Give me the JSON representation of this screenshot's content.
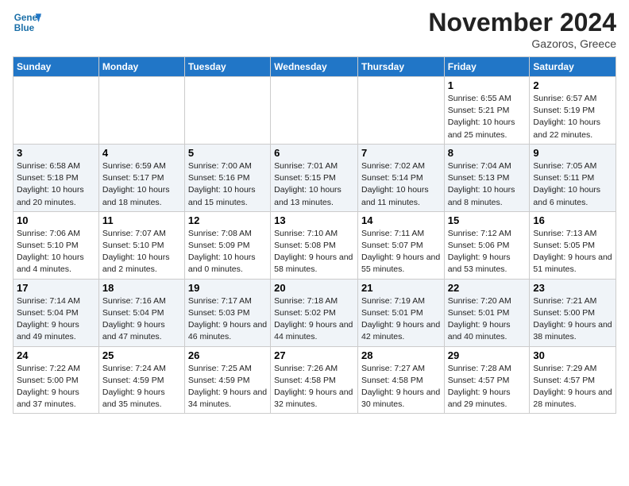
{
  "header": {
    "logo_line1": "General",
    "logo_line2": "Blue",
    "month": "November 2024",
    "location": "Gazoros, Greece"
  },
  "days_of_week": [
    "Sunday",
    "Monday",
    "Tuesday",
    "Wednesday",
    "Thursday",
    "Friday",
    "Saturday"
  ],
  "weeks": [
    [
      {
        "day": "",
        "info": ""
      },
      {
        "day": "",
        "info": ""
      },
      {
        "day": "",
        "info": ""
      },
      {
        "day": "",
        "info": ""
      },
      {
        "day": "",
        "info": ""
      },
      {
        "day": "1",
        "info": "Sunrise: 6:55 AM\nSunset: 5:21 PM\nDaylight: 10 hours and 25 minutes."
      },
      {
        "day": "2",
        "info": "Sunrise: 6:57 AM\nSunset: 5:19 PM\nDaylight: 10 hours and 22 minutes."
      }
    ],
    [
      {
        "day": "3",
        "info": "Sunrise: 6:58 AM\nSunset: 5:18 PM\nDaylight: 10 hours and 20 minutes."
      },
      {
        "day": "4",
        "info": "Sunrise: 6:59 AM\nSunset: 5:17 PM\nDaylight: 10 hours and 18 minutes."
      },
      {
        "day": "5",
        "info": "Sunrise: 7:00 AM\nSunset: 5:16 PM\nDaylight: 10 hours and 15 minutes."
      },
      {
        "day": "6",
        "info": "Sunrise: 7:01 AM\nSunset: 5:15 PM\nDaylight: 10 hours and 13 minutes."
      },
      {
        "day": "7",
        "info": "Sunrise: 7:02 AM\nSunset: 5:14 PM\nDaylight: 10 hours and 11 minutes."
      },
      {
        "day": "8",
        "info": "Sunrise: 7:04 AM\nSunset: 5:13 PM\nDaylight: 10 hours and 8 minutes."
      },
      {
        "day": "9",
        "info": "Sunrise: 7:05 AM\nSunset: 5:11 PM\nDaylight: 10 hours and 6 minutes."
      }
    ],
    [
      {
        "day": "10",
        "info": "Sunrise: 7:06 AM\nSunset: 5:10 PM\nDaylight: 10 hours and 4 minutes."
      },
      {
        "day": "11",
        "info": "Sunrise: 7:07 AM\nSunset: 5:10 PM\nDaylight: 10 hours and 2 minutes."
      },
      {
        "day": "12",
        "info": "Sunrise: 7:08 AM\nSunset: 5:09 PM\nDaylight: 10 hours and 0 minutes."
      },
      {
        "day": "13",
        "info": "Sunrise: 7:10 AM\nSunset: 5:08 PM\nDaylight: 9 hours and 58 minutes."
      },
      {
        "day": "14",
        "info": "Sunrise: 7:11 AM\nSunset: 5:07 PM\nDaylight: 9 hours and 55 minutes."
      },
      {
        "day": "15",
        "info": "Sunrise: 7:12 AM\nSunset: 5:06 PM\nDaylight: 9 hours and 53 minutes."
      },
      {
        "day": "16",
        "info": "Sunrise: 7:13 AM\nSunset: 5:05 PM\nDaylight: 9 hours and 51 minutes."
      }
    ],
    [
      {
        "day": "17",
        "info": "Sunrise: 7:14 AM\nSunset: 5:04 PM\nDaylight: 9 hours and 49 minutes."
      },
      {
        "day": "18",
        "info": "Sunrise: 7:16 AM\nSunset: 5:04 PM\nDaylight: 9 hours and 47 minutes."
      },
      {
        "day": "19",
        "info": "Sunrise: 7:17 AM\nSunset: 5:03 PM\nDaylight: 9 hours and 46 minutes."
      },
      {
        "day": "20",
        "info": "Sunrise: 7:18 AM\nSunset: 5:02 PM\nDaylight: 9 hours and 44 minutes."
      },
      {
        "day": "21",
        "info": "Sunrise: 7:19 AM\nSunset: 5:01 PM\nDaylight: 9 hours and 42 minutes."
      },
      {
        "day": "22",
        "info": "Sunrise: 7:20 AM\nSunset: 5:01 PM\nDaylight: 9 hours and 40 minutes."
      },
      {
        "day": "23",
        "info": "Sunrise: 7:21 AM\nSunset: 5:00 PM\nDaylight: 9 hours and 38 minutes."
      }
    ],
    [
      {
        "day": "24",
        "info": "Sunrise: 7:22 AM\nSunset: 5:00 PM\nDaylight: 9 hours and 37 minutes."
      },
      {
        "day": "25",
        "info": "Sunrise: 7:24 AM\nSunset: 4:59 PM\nDaylight: 9 hours and 35 minutes."
      },
      {
        "day": "26",
        "info": "Sunrise: 7:25 AM\nSunset: 4:59 PM\nDaylight: 9 hours and 34 minutes."
      },
      {
        "day": "27",
        "info": "Sunrise: 7:26 AM\nSunset: 4:58 PM\nDaylight: 9 hours and 32 minutes."
      },
      {
        "day": "28",
        "info": "Sunrise: 7:27 AM\nSunset: 4:58 PM\nDaylight: 9 hours and 30 minutes."
      },
      {
        "day": "29",
        "info": "Sunrise: 7:28 AM\nSunset: 4:57 PM\nDaylight: 9 hours and 29 minutes."
      },
      {
        "day": "30",
        "info": "Sunrise: 7:29 AM\nSunset: 4:57 PM\nDaylight: 9 hours and 28 minutes."
      }
    ]
  ]
}
